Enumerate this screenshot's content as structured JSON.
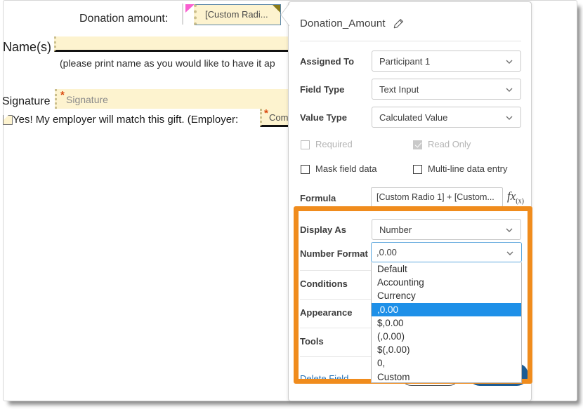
{
  "document": {
    "donation_label": "Donation amount:",
    "custom_radio_field": "[Custom Radi...",
    "names_label": "Name(s)",
    "print_note": "(please print name as you would like to have it ap",
    "signature_label": "Signature",
    "signature_field": "Signature",
    "signature_required_mark": "*",
    "match_gift_text": "Yes!  My employer will match this gift.  (Employer:",
    "employer_field": "Com",
    "employer_required_mark": "*"
  },
  "panel": {
    "title": "Donation_Amount",
    "edit_icon": "pencil-icon",
    "rows": [
      {
        "label": "Assigned To",
        "value": "Participant 1"
      },
      {
        "label": "Field Type",
        "value": "Text Input"
      },
      {
        "label": "Value Type",
        "value": "Calculated Value"
      }
    ],
    "checkboxes": [
      {
        "label": "Required",
        "checked": false,
        "disabled": true
      },
      {
        "label": "Read Only",
        "checked": true,
        "disabled": true
      },
      {
        "label": "Mask field data",
        "checked": false,
        "disabled": false
      },
      {
        "label": "Multi-line data entry",
        "checked": false,
        "disabled": false
      }
    ],
    "formula": {
      "label": "Formula",
      "value": "[Custom Radio 1] + [Custom...",
      "fx_icon": "fx",
      "fx_sub": "(x)"
    },
    "display_as": {
      "label": "Display As",
      "value": "Number"
    },
    "number_format": {
      "label": "Number Format",
      "value": ",0.00"
    },
    "accordion": [
      {
        "label": "Conditions"
      },
      {
        "label": "Appearance"
      },
      {
        "label": "Tools"
      }
    ],
    "delete_field": "Delete Field",
    "buttons": {
      "cancel": "",
      "save": ""
    }
  },
  "dropdown": {
    "options": [
      "Default",
      "Accounting",
      "Currency",
      ",0.00",
      "$,0.00",
      "(,0.00)",
      "$(,0.00)",
      "0,",
      "Custom"
    ],
    "selected_index": 3
  },
  "colors": {
    "highlight_box": "#f08c1d",
    "dropdown_selected": "#1e90e8",
    "focus_border": "#5fa8dd",
    "link": "#1f6fb5",
    "save_button": "#1c5c94",
    "field_yellow": "#fdf3cf"
  }
}
